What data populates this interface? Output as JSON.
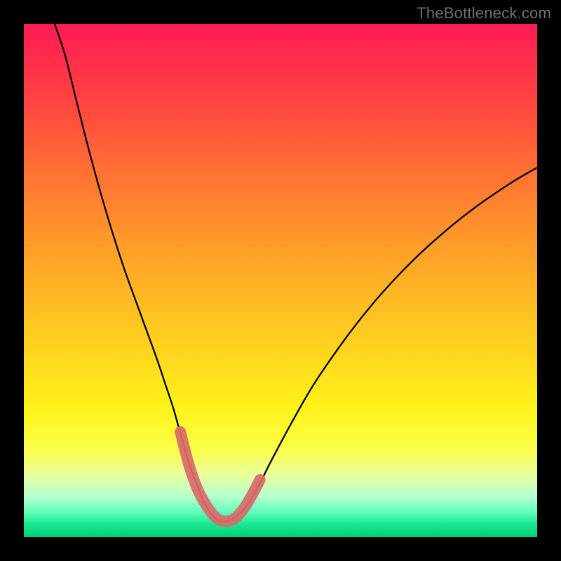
{
  "watermark": "TheBottleneck.com",
  "chart_data": {
    "type": "line",
    "title": "",
    "xlabel": "",
    "ylabel": "",
    "xlim": [
      0,
      100
    ],
    "ylim": [
      0,
      100
    ],
    "grid": false,
    "legend": null,
    "gradient_stops": [
      {
        "offset": 0.0,
        "color": "#ff1a53"
      },
      {
        "offset": 0.12,
        "color": "#ff3a45"
      },
      {
        "offset": 0.28,
        "color": "#ff6e34"
      },
      {
        "offset": 0.45,
        "color": "#ffa228"
      },
      {
        "offset": 0.62,
        "color": "#ffd020"
      },
      {
        "offset": 0.75,
        "color": "#fff31a"
      },
      {
        "offset": 0.83,
        "color": "#fbff4a"
      },
      {
        "offset": 0.88,
        "color": "#e8ffa0"
      },
      {
        "offset": 0.92,
        "color": "#b6ffce"
      },
      {
        "offset": 0.95,
        "color": "#66ffbb"
      },
      {
        "offset": 0.975,
        "color": "#17e88f"
      },
      {
        "offset": 1.0,
        "color": "#00d079"
      }
    ],
    "series": [
      {
        "name": "bottleneck-curve",
        "color": "#000000",
        "stroke_width": 2.3,
        "x": [
          6,
          8,
          10,
          12,
          14,
          16,
          18,
          20,
          22,
          24,
          26,
          27.5,
          29,
          30,
          31,
          32,
          33,
          34,
          35,
          36,
          37,
          38,
          39,
          40,
          42,
          44,
          46,
          48,
          52,
          56,
          60,
          64,
          68,
          72,
          76,
          80,
          84,
          88,
          92,
          96,
          100
        ],
        "values": [
          100,
          94,
          86,
          78,
          70.5,
          63.5,
          57,
          51,
          45.5,
          40,
          34.5,
          30,
          25.5,
          22,
          18.5,
          15,
          12,
          9.5,
          7,
          5.2,
          4,
          3.2,
          3.1,
          3.2,
          4.5,
          7,
          10.5,
          14.5,
          22,
          29,
          35,
          40.5,
          45.5,
          50,
          54.1,
          57.8,
          61.2,
          64.3,
          67.1,
          69.7,
          72
        ]
      },
      {
        "name": "highlight-region",
        "color": "#d96b6b",
        "stroke_width": 16,
        "linecap": "round",
        "x": [
          30.5,
          31.5,
          32.5,
          34,
          36,
          38,
          40,
          41.5,
          43,
          44.5,
          46
        ],
        "values": [
          20.5,
          16.5,
          13,
          9,
          5.5,
          3.4,
          3.2,
          4.0,
          5.8,
          8.3,
          11.2
        ]
      }
    ],
    "annotations": []
  }
}
